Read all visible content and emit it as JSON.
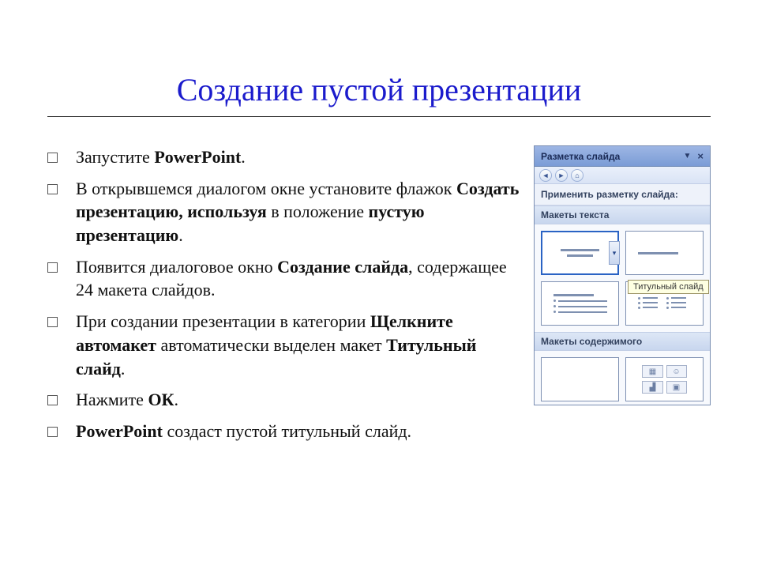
{
  "title": "Создание пустой презентации",
  "bullets": [
    {
      "pre": "Запустите ",
      "b1": "PowerPoint",
      "post": "."
    },
    {
      "pre": "В открывшемся диалогом окне установите флажок ",
      "b1": "Создать презентацию, используя",
      "mid": " в положение ",
      "b2": "пустую презентацию",
      "post": "."
    },
    {
      "pre": "Появится диалоговое окно ",
      "b1": "Создание слайда",
      "post": ", содержащее 24 макета слайдов."
    },
    {
      "pre": "При создании презентации в категории ",
      "b1": "Щелкните автомакет",
      "mid": " автоматически выделен макет ",
      "b2": "Титульный слайд",
      "post": "."
    },
    {
      "pre": "Нажмите ",
      "b1": "ОК",
      "post": "."
    },
    {
      "b1": "PowerPoint",
      "post": " создаст пустой титульный слайд."
    }
  ],
  "taskpane": {
    "title": "Разметка слайда",
    "apply_label": "Применить разметку слайда:",
    "section_text": "Макеты текста",
    "section_content": "Макеты содержимого",
    "tooltip": "Титульный слайд"
  }
}
